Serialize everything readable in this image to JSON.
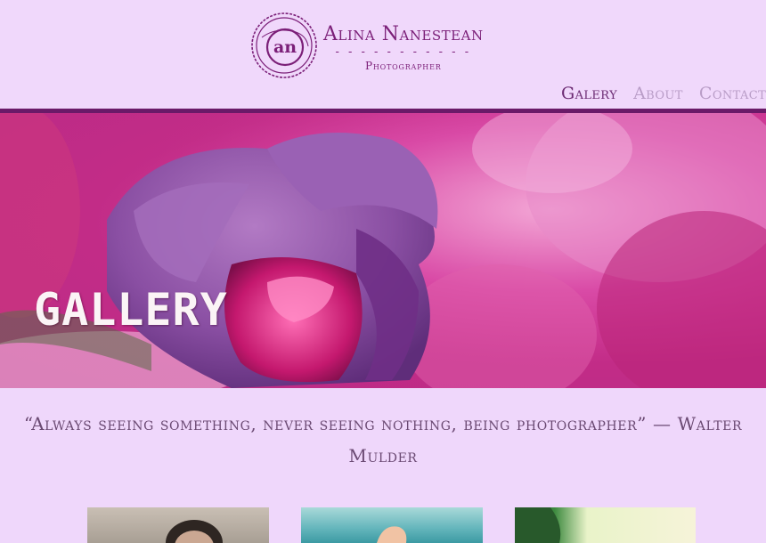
{
  "brand": {
    "monogram": "an",
    "name": "Alina Nanestean",
    "divider": "- - - - - - - - - - -",
    "subtitle": "Photographer"
  },
  "nav": {
    "items": [
      {
        "label": "Galery",
        "active": true
      },
      {
        "label": "About",
        "active": false
      },
      {
        "label": "Contact",
        "active": false
      }
    ]
  },
  "hero": {
    "title": "GALLERY"
  },
  "quote": {
    "line1": "“Always seeing something, never seeing nothing, being photographer” — Walter",
    "line2": "Mulder"
  },
  "colors": {
    "accent": "#6a1a68",
    "background": "#efd7fb",
    "nav_active": "#6c2b73",
    "nav_inactive": "#b99dc7"
  }
}
